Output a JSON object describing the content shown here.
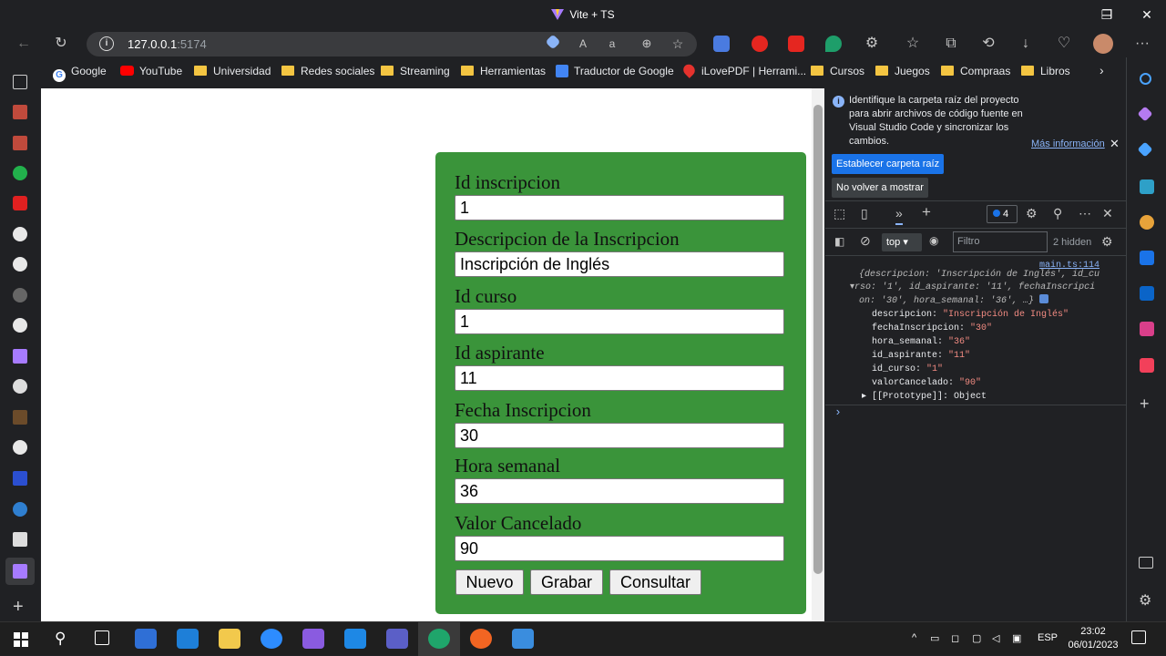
{
  "window": {
    "title": "Vite + TS",
    "minimize": "─",
    "maximize": "❐",
    "close": "✕"
  },
  "toolbar": {
    "back": "←",
    "reload": "↻",
    "address_host": "127.0.0.1",
    "address_port": ":5174",
    "info": "i",
    "more": "···"
  },
  "bookmarks": [
    {
      "label": "Google"
    },
    {
      "label": "YouTube"
    },
    {
      "label": "Universidad"
    },
    {
      "label": "Redes sociales"
    },
    {
      "label": "Streaming"
    },
    {
      "label": "Herramientas"
    },
    {
      "label": "Traductor de Google"
    },
    {
      "label": "iLovePDF | Herrami..."
    },
    {
      "label": "Cursos"
    },
    {
      "label": "Juegos"
    },
    {
      "label": "Compraas"
    },
    {
      "label": "Libros"
    }
  ],
  "form": {
    "id_inscripcion_label": "Id inscripcion",
    "id_inscripcion_value": "1",
    "descripcion_label": "Descripcion de la Inscripcion",
    "descripcion_value": "Inscripción de Inglés",
    "id_curso_label": "Id curso",
    "id_curso_value": "1",
    "id_aspirante_label": "Id aspirante",
    "id_aspirante_value": "11",
    "fecha_label": "Fecha Inscripcion",
    "fecha_value": "30",
    "hora_label": "Hora semanal",
    "hora_value": "36",
    "valor_label": "Valor Cancelado",
    "valor_value": "90",
    "btn_nuevo": "Nuevo",
    "btn_grabar": "Grabar",
    "btn_consultar": "Consultar"
  },
  "devtools": {
    "notice_text": "Identifique la carpeta raíz del proyecto para abrir archivos de código fuente en Visual Studio Code y sincronizar los cambios.",
    "notice_more": "Más información",
    "btn_set_root": "Establecer carpeta raíz",
    "btn_dont_show": "No volver a mostrar",
    "issues_count": "4",
    "context": "top",
    "filter_placeholder": "Filtro",
    "hidden_count": "2 hidden",
    "source_link": "main.ts:114",
    "log_line1": "{descripcion: 'Inscripción de Inglés', id_cu",
    "log_line2": "rso: '1', id_aspirante: '11', fechaInscripci",
    "log_line3": "on: '30', hora_semanal: '36', …}",
    "props": [
      {
        "key": "descripcion",
        "value": "\"Inscripción de Inglés\""
      },
      {
        "key": "fechaInscripcion",
        "value": "\"30\""
      },
      {
        "key": "hora_semanal",
        "value": "\"36\""
      },
      {
        "key": "id_aspirante",
        "value": "\"11\""
      },
      {
        "key": "id_curso",
        "value": "\"1\""
      },
      {
        "key": "valorCancelado",
        "value": "\"90\""
      }
    ],
    "prototype": "[[Prototype]]: Object",
    "prompt": "›"
  },
  "taskbar": {
    "language": "ESP",
    "time": "23:02",
    "date": "06/01/2023"
  }
}
